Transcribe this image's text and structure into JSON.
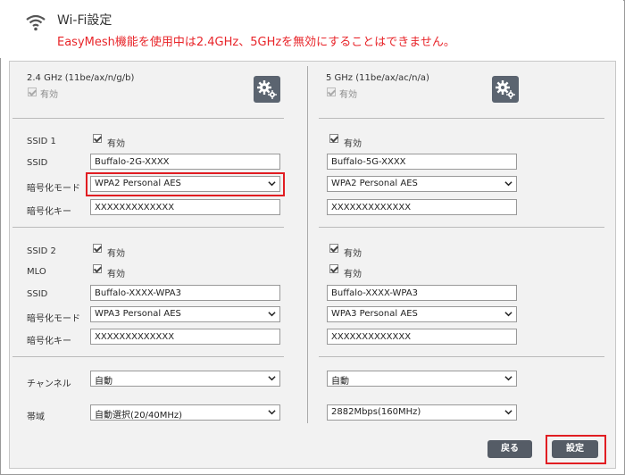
{
  "header": {
    "title": "Wi-Fi設定",
    "warning": "EasyMesh機能を使用中は2.4GHz、5GHzを無効にすることはできません。"
  },
  "labels": {
    "ssid1": "SSID 1",
    "ssid": "SSID",
    "enc_mode": "暗号化モード",
    "enc_key": "暗号化キー",
    "ssid2": "SSID 2",
    "mlo": "MLO",
    "channel": "チャンネル",
    "bandwidth": "帯域",
    "enabled": "有効"
  },
  "band24": {
    "title": "2.4 GHz (11be/ax/n/g/b)",
    "ssid1_ssid": "Buffalo-2G-XXXX",
    "ssid1_enc": "WPA2 Personal AES",
    "ssid1_key": "XXXXXXXXXXXXX",
    "ssid2_ssid": "Buffalo-XXXX-WPA3",
    "ssid2_enc": "WPA3 Personal AES",
    "ssid2_key": "XXXXXXXXXXXXX",
    "channel": "自動",
    "bandwidth": "自動選択(20/40MHz)"
  },
  "band5": {
    "title": "5 GHz (11be/ax/ac/n/a)",
    "ssid1_ssid": "Buffalo-5G-XXXX",
    "ssid1_enc": "WPA2 Personal AES",
    "ssid1_key": "XXXXXXXXXXXXX",
    "ssid2_ssid": "Buffalo-XXXX-WPA3",
    "ssid2_enc": "WPA3 Personal AES",
    "ssid2_key": "XXXXXXXXXXXXX",
    "channel": "自動",
    "bandwidth": "2882Mbps(160MHz)"
  },
  "buttons": {
    "back": "戻る",
    "apply": "設定"
  },
  "colors": {
    "warning": "#e8252a",
    "highlight": "#e11d22",
    "button": "#555c66"
  }
}
